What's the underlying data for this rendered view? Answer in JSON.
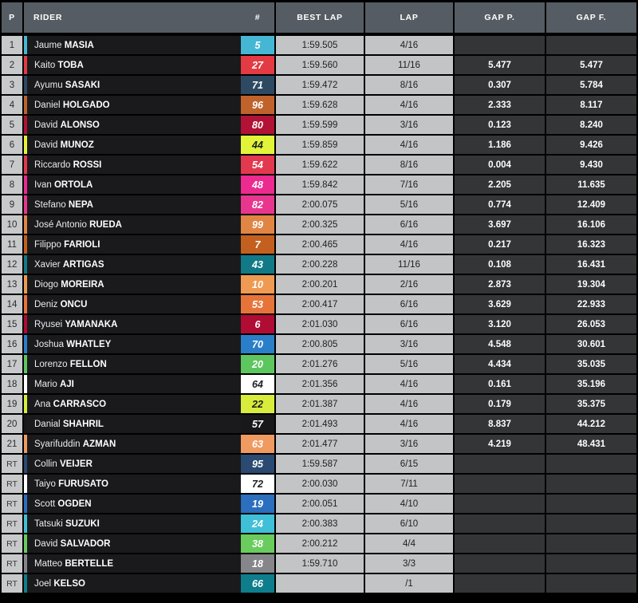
{
  "header": {
    "position": "P",
    "rider": "RIDER",
    "number": "#",
    "best_lap": "BEST LAP",
    "lap": "LAP",
    "gap_p": "GAP P.",
    "gap_f": "GAP F."
  },
  "colors": {
    "header_bg": "#555c63",
    "position_bg": "#c7c9cb",
    "rider_bg": "#1a1a1c",
    "time_bg": "#c2c4c6",
    "gap_bg": "#333537",
    "page_bg": "#000000"
  },
  "rows": [
    {
      "pos": "1",
      "first": "Jaume",
      "last": "MASIA",
      "num": "5",
      "num_bg": "#45b7d4",
      "num_fg": "#ffffff",
      "best": "1:59.505",
      "lap": "4/16",
      "gap_p": "",
      "gap_f": ""
    },
    {
      "pos": "2",
      "first": "Kaito",
      "last": "TOBA",
      "num": "27",
      "num_bg": "#e23b43",
      "num_fg": "#ffffff",
      "best": "1:59.560",
      "lap": "11/16",
      "gap_p": "5.477",
      "gap_f": "5.477"
    },
    {
      "pos": "3",
      "first": "Ayumu",
      "last": "SASAKI",
      "num": "71",
      "num_bg": "#2e4a63",
      "num_fg": "#ffffff",
      "best": "1:59.472",
      "lap": "8/16",
      "gap_p": "0.307",
      "gap_f": "5.784"
    },
    {
      "pos": "4",
      "first": "Daniel",
      "last": "HOLGADO",
      "num": "96",
      "num_bg": "#c0622c",
      "num_fg": "#ffffff",
      "best": "1:59.628",
      "lap": "4/16",
      "gap_p": "2.333",
      "gap_f": "8.117"
    },
    {
      "pos": "5",
      "first": "David",
      "last": "ALONSO",
      "num": "80",
      "num_bg": "#b21236",
      "num_fg": "#ffffff",
      "best": "1:59.599",
      "lap": "3/16",
      "gap_p": "0.123",
      "gap_f": "8.240"
    },
    {
      "pos": "6",
      "first": "David",
      "last": "MUÑOZ",
      "num": "44",
      "num_bg": "#e2f43a",
      "num_fg": "#1d1f21",
      "best": "1:59.859",
      "lap": "4/16",
      "gap_p": "1.186",
      "gap_f": "9.426"
    },
    {
      "pos": "7",
      "first": "Riccardo",
      "last": "ROSSI",
      "num": "54",
      "num_bg": "#e2394f",
      "num_fg": "#ffffff",
      "best": "1:59.622",
      "lap": "8/16",
      "gap_p": "0.004",
      "gap_f": "9.430"
    },
    {
      "pos": "8",
      "first": "Ivan",
      "last": "ORTOLÁ",
      "num": "48",
      "num_bg": "#ec2a8f",
      "num_fg": "#ffffff",
      "best": "1:59.842",
      "lap": "7/16",
      "gap_p": "2.205",
      "gap_f": "11.635"
    },
    {
      "pos": "9",
      "first": "Stefano",
      "last": "NEPA",
      "num": "82",
      "num_bg": "#e8368f",
      "num_fg": "#ffffff",
      "best": "2:00.075",
      "lap": "5/16",
      "gap_p": "0.774",
      "gap_f": "12.409"
    },
    {
      "pos": "10",
      "first": "José Antonio",
      "last": "RUEDA",
      "num": "99",
      "num_bg": "#e08544",
      "num_fg": "#ffffff",
      "best": "2:00.325",
      "lap": "6/16",
      "gap_p": "3.697",
      "gap_f": "16.106"
    },
    {
      "pos": "11",
      "first": "Filippo",
      "last": "FARIOLI",
      "num": "7",
      "num_bg": "#c4601f",
      "num_fg": "#ffffff",
      "best": "2:00.465",
      "lap": "4/16",
      "gap_p": "0.217",
      "gap_f": "16.323"
    },
    {
      "pos": "12",
      "first": "Xavier",
      "last": "ARTIGAS",
      "num": "43",
      "num_bg": "#127a87",
      "num_fg": "#ffffff",
      "best": "2:00.228",
      "lap": "11/16",
      "gap_p": "0.108",
      "gap_f": "16.431"
    },
    {
      "pos": "13",
      "first": "Diogo",
      "last": "MOREIRA",
      "num": "10",
      "num_bg": "#ef9a52",
      "num_fg": "#ffffff",
      "best": "2:00.201",
      "lap": "2/16",
      "gap_p": "2.873",
      "gap_f": "19.304"
    },
    {
      "pos": "14",
      "first": "Deniz",
      "last": "ÖNCÜ",
      "num": "53",
      "num_bg": "#e6743a",
      "num_fg": "#ffffff",
      "best": "2:00.417",
      "lap": "6/16",
      "gap_p": "3.629",
      "gap_f": "22.933"
    },
    {
      "pos": "15",
      "first": "Ryusei",
      "last": "YAMANAKA",
      "num": "6",
      "num_bg": "#b00c34",
      "num_fg": "#ffffff",
      "best": "2:01.030",
      "lap": "6/16",
      "gap_p": "3.120",
      "gap_f": "26.053"
    },
    {
      "pos": "16",
      "first": "Joshua",
      "last": "WHATLEY",
      "num": "70",
      "num_bg": "#2b7fc8",
      "num_fg": "#ffffff",
      "best": "2:00.805",
      "lap": "3/16",
      "gap_p": "4.548",
      "gap_f": "30.601"
    },
    {
      "pos": "17",
      "first": "Lorenzo",
      "last": "FELLON",
      "num": "20",
      "num_bg": "#5dc65f",
      "num_fg": "#ffffff",
      "best": "2:01.276",
      "lap": "5/16",
      "gap_p": "4.434",
      "gap_f": "35.035"
    },
    {
      "pos": "18",
      "first": "Mario",
      "last": "AJI",
      "num": "64",
      "num_bg": "#ffffff",
      "num_fg": "#1d1f21",
      "best": "2:01.356",
      "lap": "4/16",
      "gap_p": "0.161",
      "gap_f": "35.196"
    },
    {
      "pos": "19",
      "first": "Ana",
      "last": "CARRASCO",
      "num": "22",
      "num_bg": "#d8ec3c",
      "num_fg": "#1d1f21",
      "best": "2:01.387",
      "lap": "4/16",
      "gap_p": "0.179",
      "gap_f": "35.375"
    },
    {
      "pos": "20",
      "first": "Danial",
      "last": "SHAHRIL",
      "num": "57",
      "num_bg": "#18181a",
      "num_fg": "#ffffff",
      "best": "2:01.493",
      "lap": "4/16",
      "gap_p": "8.837",
      "gap_f": "44.212"
    },
    {
      "pos": "21",
      "first": "Syarifuddin",
      "last": "AZMAN",
      "num": "63",
      "num_bg": "#ef9a61",
      "num_fg": "#ffffff",
      "best": "2:01.477",
      "lap": "3/16",
      "gap_p": "4.219",
      "gap_f": "48.431"
    },
    {
      "pos": "RT",
      "first": "Collin",
      "last": "VEIJER",
      "num": "95",
      "num_bg": "#2b4a72",
      "num_fg": "#ffffff",
      "best": "1:59.587",
      "lap": "6/15",
      "gap_p": "",
      "gap_f": ""
    },
    {
      "pos": "RT",
      "first": "Taiyo",
      "last": "FURUSATO",
      "num": "72",
      "num_bg": "#ffffff",
      "num_fg": "#1d1f21",
      "best": "2:00.030",
      "lap": "7/11",
      "gap_p": "",
      "gap_f": ""
    },
    {
      "pos": "RT",
      "first": "Scott",
      "last": "OGDEN",
      "num": "19",
      "num_bg": "#2b6fbe",
      "num_fg": "#ffffff",
      "best": "2:00.051",
      "lap": "4/10",
      "gap_p": "",
      "gap_f": ""
    },
    {
      "pos": "RT",
      "first": "Tatsuki",
      "last": "SUZUKI",
      "num": "24",
      "num_bg": "#3fc0d8",
      "num_fg": "#ffffff",
      "best": "2:00.383",
      "lap": "6/10",
      "gap_p": "",
      "gap_f": ""
    },
    {
      "pos": "RT",
      "first": "David",
      "last": "SALVADOR",
      "num": "38",
      "num_bg": "#69cc5d",
      "num_fg": "#ffffff",
      "best": "2:00.212",
      "lap": "4/4",
      "gap_p": "",
      "gap_f": ""
    },
    {
      "pos": "RT",
      "first": "Matteo",
      "last": "BERTELLE",
      "num": "18",
      "num_bg": "#86868a",
      "num_fg": "#ffffff",
      "best": "1:59.710",
      "lap": "3/3",
      "gap_p": "",
      "gap_f": ""
    },
    {
      "pos": "RT",
      "first": "Joel",
      "last": "KELSO",
      "num": "66",
      "num_bg": "#0e7d8c",
      "num_fg": "#ffffff",
      "best": "",
      "lap": "/1",
      "gap_p": "",
      "gap_f": ""
    }
  ]
}
